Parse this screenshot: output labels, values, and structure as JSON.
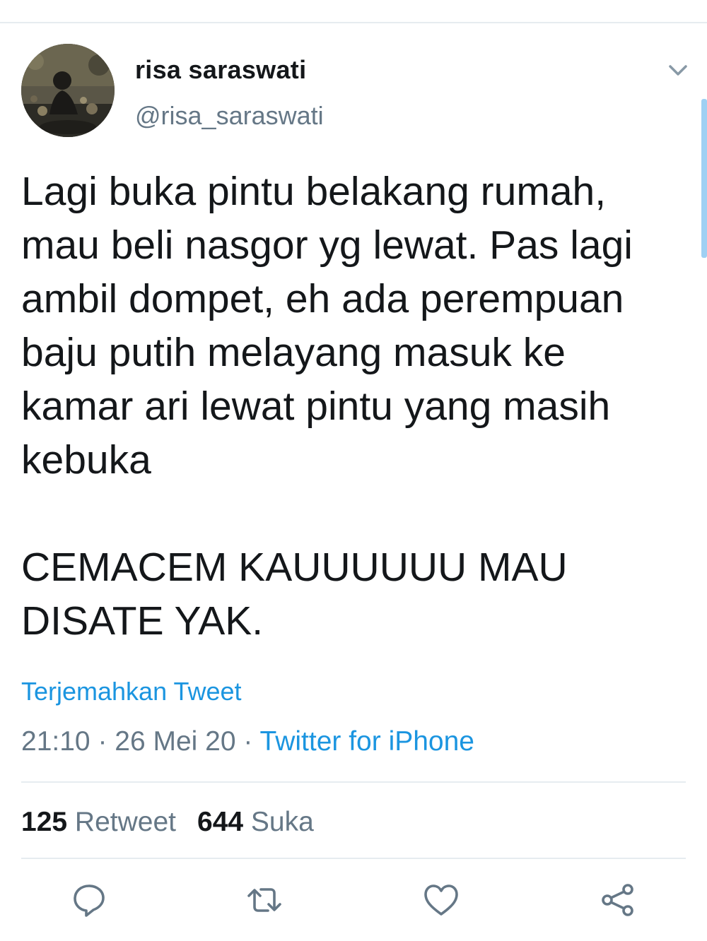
{
  "author": {
    "display_name": "risa saraswati",
    "handle": "@risa_saraswati"
  },
  "tweet": {
    "text": "Lagi buka pintu belakang rumah,\nmau beli nasgor yg lewat. Pas lagi\nambil dompet, eh ada perempuan\nbaju putih melayang masuk ke\nkamar ari lewat pintu yang masih\nkebuka\n\nCEMACEM KAUUUUUU MAU\nDISATE YAK.",
    "translate_label": "Terjemahkan Tweet",
    "time": "21:10",
    "separator": " · ",
    "date": "26 Mei 20",
    "source": "Twitter for iPhone"
  },
  "stats": {
    "retweet_count": "125",
    "retweet_label": "Retweet",
    "like_count": "644",
    "like_label": "Suka"
  },
  "actions": {
    "icons": [
      "reply-icon",
      "retweet-icon",
      "like-icon",
      "share-icon"
    ]
  },
  "colors": {
    "link_blue": "#1b95e0",
    "secondary_gray": "#657786",
    "text_dark": "#14171a",
    "divider": "#e6ecf0"
  }
}
